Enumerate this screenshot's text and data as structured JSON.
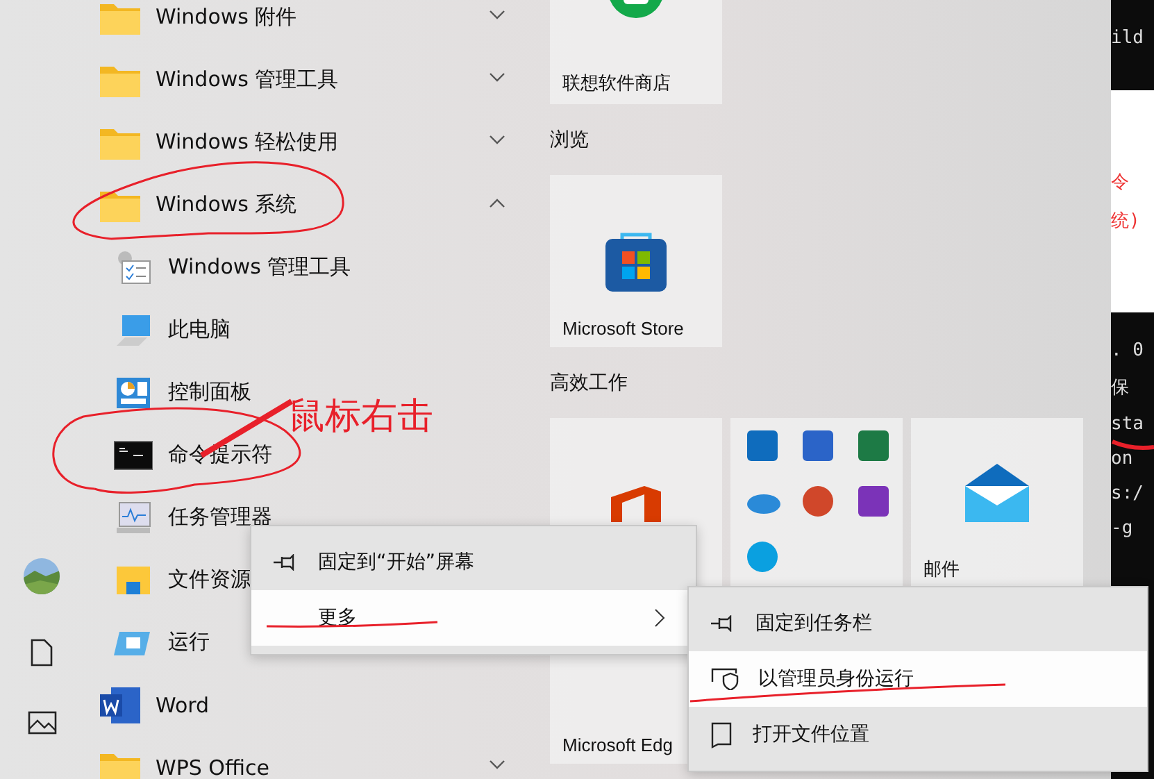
{
  "rail": [
    {
      "kind": "avatar"
    },
    {
      "kind": "documents"
    },
    {
      "kind": "pictures"
    }
  ],
  "app_list": [
    {
      "kind": "folder",
      "label": "Windows 附件",
      "expanded": false
    },
    {
      "kind": "folder",
      "label": "Windows 管理工具",
      "expanded": false
    },
    {
      "kind": "folder",
      "label": "Windows 轻松使用",
      "expanded": false
    },
    {
      "kind": "folder",
      "label": "Windows 系统",
      "expanded": true,
      "children": [
        {
          "kind": "admin-tools",
          "label": "Windows 管理工具"
        },
        {
          "kind": "computer",
          "label": "此电脑"
        },
        {
          "kind": "control-panel",
          "label": "控制面板"
        },
        {
          "kind": "terminal",
          "label": "命令提示符"
        },
        {
          "kind": "task-manager",
          "label": "任务管理器"
        },
        {
          "kind": "explorer",
          "label": "文件资源"
        },
        {
          "kind": "run",
          "label": "运行"
        }
      ]
    },
    {
      "kind": "word",
      "label": "Word"
    },
    {
      "kind": "folder",
      "label": "WPS Office",
      "expanded": false
    }
  ],
  "tile_groups": [
    {
      "tiles": [
        {
          "kind": "lenovo-store",
          "label": "联想软件商店"
        }
      ]
    },
    {
      "title": "浏览",
      "tiles": [
        {
          "kind": "ms-store",
          "label": "Microsoft Store"
        }
      ]
    },
    {
      "title": "高效工作",
      "tiles": [
        {
          "kind": "office"
        },
        {
          "kind": "office-apps"
        },
        {
          "kind": "mail",
          "label": "邮件"
        },
        {
          "kind": "edge",
          "label": "Microsoft Edg"
        }
      ]
    }
  ],
  "context_menu": {
    "items": [
      {
        "kind": "pin",
        "label": "固定到“开始”屏幕",
        "selected": false
      },
      {
        "kind": "more",
        "label": "更多",
        "selected": true
      }
    ]
  },
  "submenu": {
    "items": [
      {
        "kind": "pin",
        "label": "固定到任务栏",
        "selected": false
      },
      {
        "kind": "shield",
        "label": "以管理员身份运行",
        "selected": true
      },
      {
        "kind": "folder",
        "label": "打开文件位置",
        "selected": false
      }
    ]
  },
  "annotation": {
    "label": "鼠标右击"
  },
  "side_window": {
    "blocks": [
      {
        "kind": "terminal",
        "lines": [
          "ild"
        ]
      },
      {
        "kind": "doc",
        "lines": [
          "令",
          "统)"
        ]
      },
      {
        "kind": "terminal",
        "lines": [
          ". 0",
          "保",
          "sta",
          "on",
          "s:/",
          "-g"
        ]
      }
    ]
  }
}
